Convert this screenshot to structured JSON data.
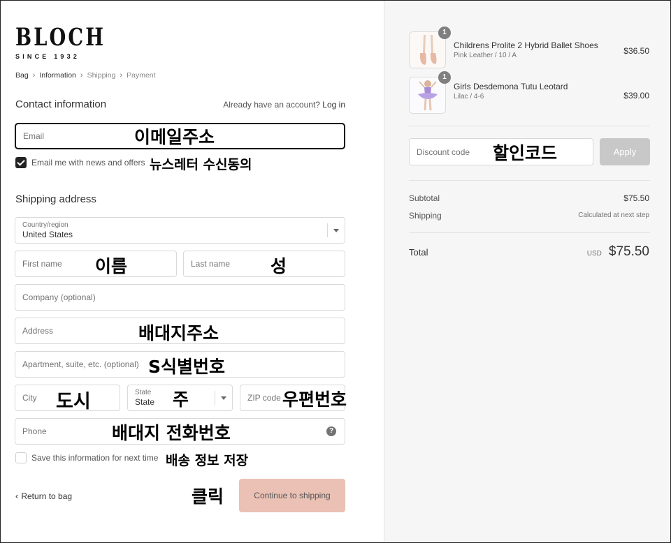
{
  "brand": {
    "name": "BLOCH",
    "tagline": "SINCE 1932"
  },
  "breadcrumb": [
    {
      "label": "Bag",
      "muted": false
    },
    {
      "label": "Information",
      "muted": false
    },
    {
      "label": "Shipping",
      "muted": true
    },
    {
      "label": "Payment",
      "muted": true
    }
  ],
  "contact": {
    "title": "Contact information",
    "account_prompt": "Already have an account?",
    "login_label": "Log in",
    "email_placeholder": "Email",
    "newsletter_label": "Email me with news and offers",
    "newsletter_checked": true
  },
  "shipping": {
    "title": "Shipping address",
    "country_label": "Country/region",
    "country_value": "United States",
    "first_name_placeholder": "First name",
    "last_name_placeholder": "Last name",
    "company_placeholder": "Company (optional)",
    "address_placeholder": "Address",
    "apartment_placeholder": "Apartment, suite, etc. (optional)",
    "city_placeholder": "City",
    "state_label": "State",
    "state_value": "State",
    "zip_placeholder": "ZIP code",
    "phone_placeholder": "Phone",
    "help_icon": "?",
    "save_info_label": "Save this information for next time",
    "save_info_checked": false
  },
  "actions": {
    "return_label": "Return to bag",
    "continue_label": "Continue to shipping"
  },
  "annotations": {
    "email": "이메일주소",
    "newsletter": "뉴스레터 수신동의",
    "first_name": "이름",
    "last_name": "성",
    "address": "배대지주소",
    "apartment": "S식별번호",
    "city": "도시",
    "state": "주",
    "zip": "우편번호",
    "phone": "배대지 전화번호",
    "save": "배송 정보 저장",
    "click": "클릭",
    "discount": "할인코드"
  },
  "cart": {
    "items": [
      {
        "name": "Childrens Prolite 2 Hybrid Ballet Shoes",
        "variant": "Pink Leather / 10 / A",
        "price": "$36.50",
        "quantity": "1"
      },
      {
        "name": "Girls Desdemona Tutu Leotard",
        "variant": "Lilac / 4-6",
        "price": "$39.00",
        "quantity": "1"
      }
    ],
    "discount_placeholder": "Discount code",
    "apply_label": "Apply",
    "subtotal_label": "Subtotal",
    "subtotal_value": "$75.50",
    "shipping_label": "Shipping",
    "shipping_value": "Calculated at next step",
    "total_label": "Total",
    "total_currency": "USD",
    "total_value": "$75.50"
  },
  "colors": {
    "continue_button": "#eac1b4",
    "apply_button": "#c8c8c8",
    "summary_background": "#f6f6f6"
  }
}
